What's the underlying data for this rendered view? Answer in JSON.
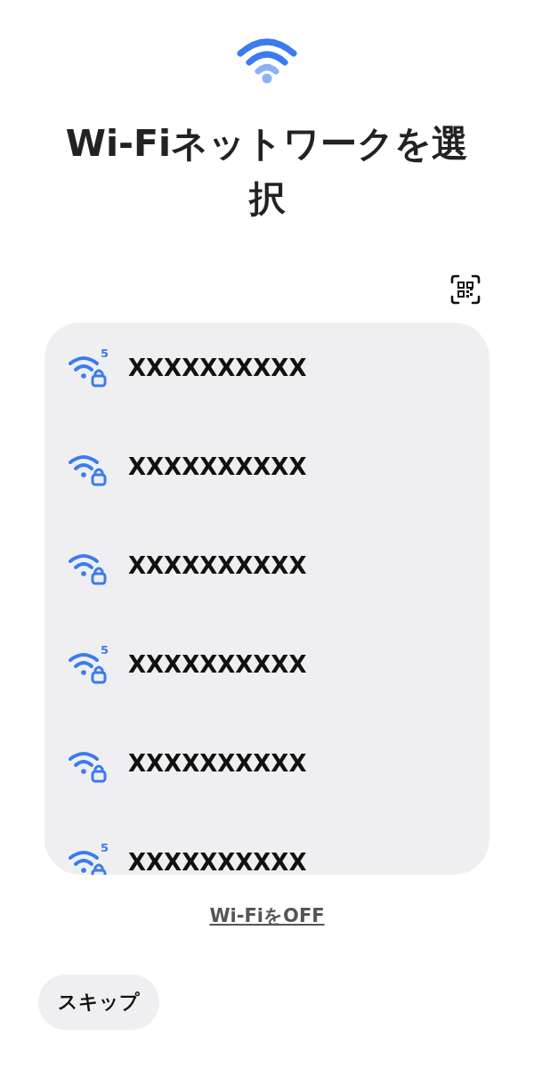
{
  "title": "Wi-Fiネットワークを選択",
  "networks": [
    {
      "name": "XXXXXXXXXX",
      "band": "5",
      "secured": true
    },
    {
      "name": "XXXXXXXXXX",
      "secured": true
    },
    {
      "name": "XXXXXXXXXX",
      "secured": true
    },
    {
      "name": "XXXXXXXXXX",
      "band": "5",
      "secured": true
    },
    {
      "name": "XXXXXXXXXX",
      "secured": true
    },
    {
      "name": "XXXXXXXXXX",
      "band": "5",
      "secured": true
    }
  ],
  "wifi_off_link": "Wi-FiをOFF",
  "skip_button": "スキップ"
}
